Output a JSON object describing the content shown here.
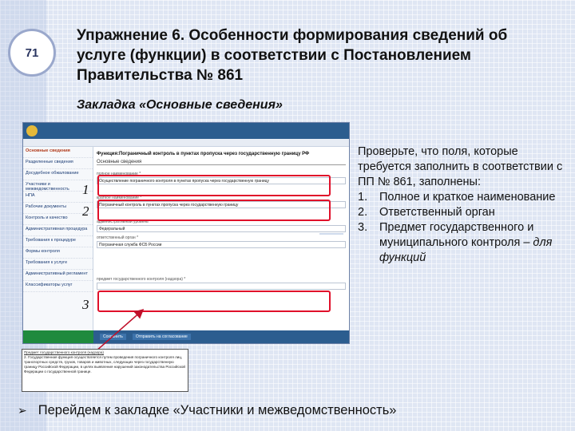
{
  "slide": {
    "number": "71",
    "title": "Упражнение 6. Особенности формирования сведений об услуге (функции) в соответствии с Постановлением Правительства № 861",
    "subtitle": "Закладка «Основные сведения»",
    "instruction_intro": "Проверьте, что поля, которые требуется заполнить в соответствии с ПП № 861, заполнены:",
    "instruction_items": [
      {
        "num": "1.",
        "text": "Полное и краткое наименование"
      },
      {
        "num": "2.",
        "text": "Ответственный орган"
      },
      {
        "num": "3.",
        "text": "Предмет государственного и муниципального контроля",
        "italic_suffix": "– для функций"
      }
    ],
    "bullet": "Перейдем к закладке «Участники и межведомственность»",
    "markers": [
      "1",
      "2",
      "3"
    ]
  },
  "screenshot": {
    "function_title": "Функция:Пограничный контроль в пунктах пропуска через государственную границу РФ",
    "section": "Основные сведения",
    "sidebar": [
      "Основные сведения",
      "Разделенные сведения",
      "Досудебное обжалование",
      "Участники и межведомственность",
      "НПА",
      "Рабочие документы",
      "Контроль и качество",
      "Административная процедура",
      "Требования к процедуре",
      "Формы контроля",
      "Требования к услуге",
      "Административный регламент",
      "Классификаторы услуг"
    ],
    "fields": [
      {
        "label": "полное наименование *",
        "value": "Осуществление пограничного контроля в пунктах пропуска через государственную границу"
      },
      {
        "label": "краткое наименование *",
        "value": "Пограничный контроль в пунктах пропуска через государственную границу"
      },
      {
        "label": "административный уровень *",
        "value": "Федеральный"
      },
      {
        "label": "ответственный орган *",
        "value": "Пограничная служба ФСБ России"
      },
      {
        "label": "предмет государственного контроля (надзора) *",
        "value": ""
      }
    ],
    "bottom_buttons": [
      "Сохранить",
      "Отправить на согласование"
    ]
  },
  "excerpt": {
    "heading": "Предмет государственного контроля (надзора)",
    "text": "2. Государственная функция осуществляется путем проведения пограничного контроля лиц, транспортных средств, грузов, товаров и животных, следующих через государственную границу Российской Федерации, в целях выявления нарушений законодательства Российской Федерации о государственной границе."
  }
}
